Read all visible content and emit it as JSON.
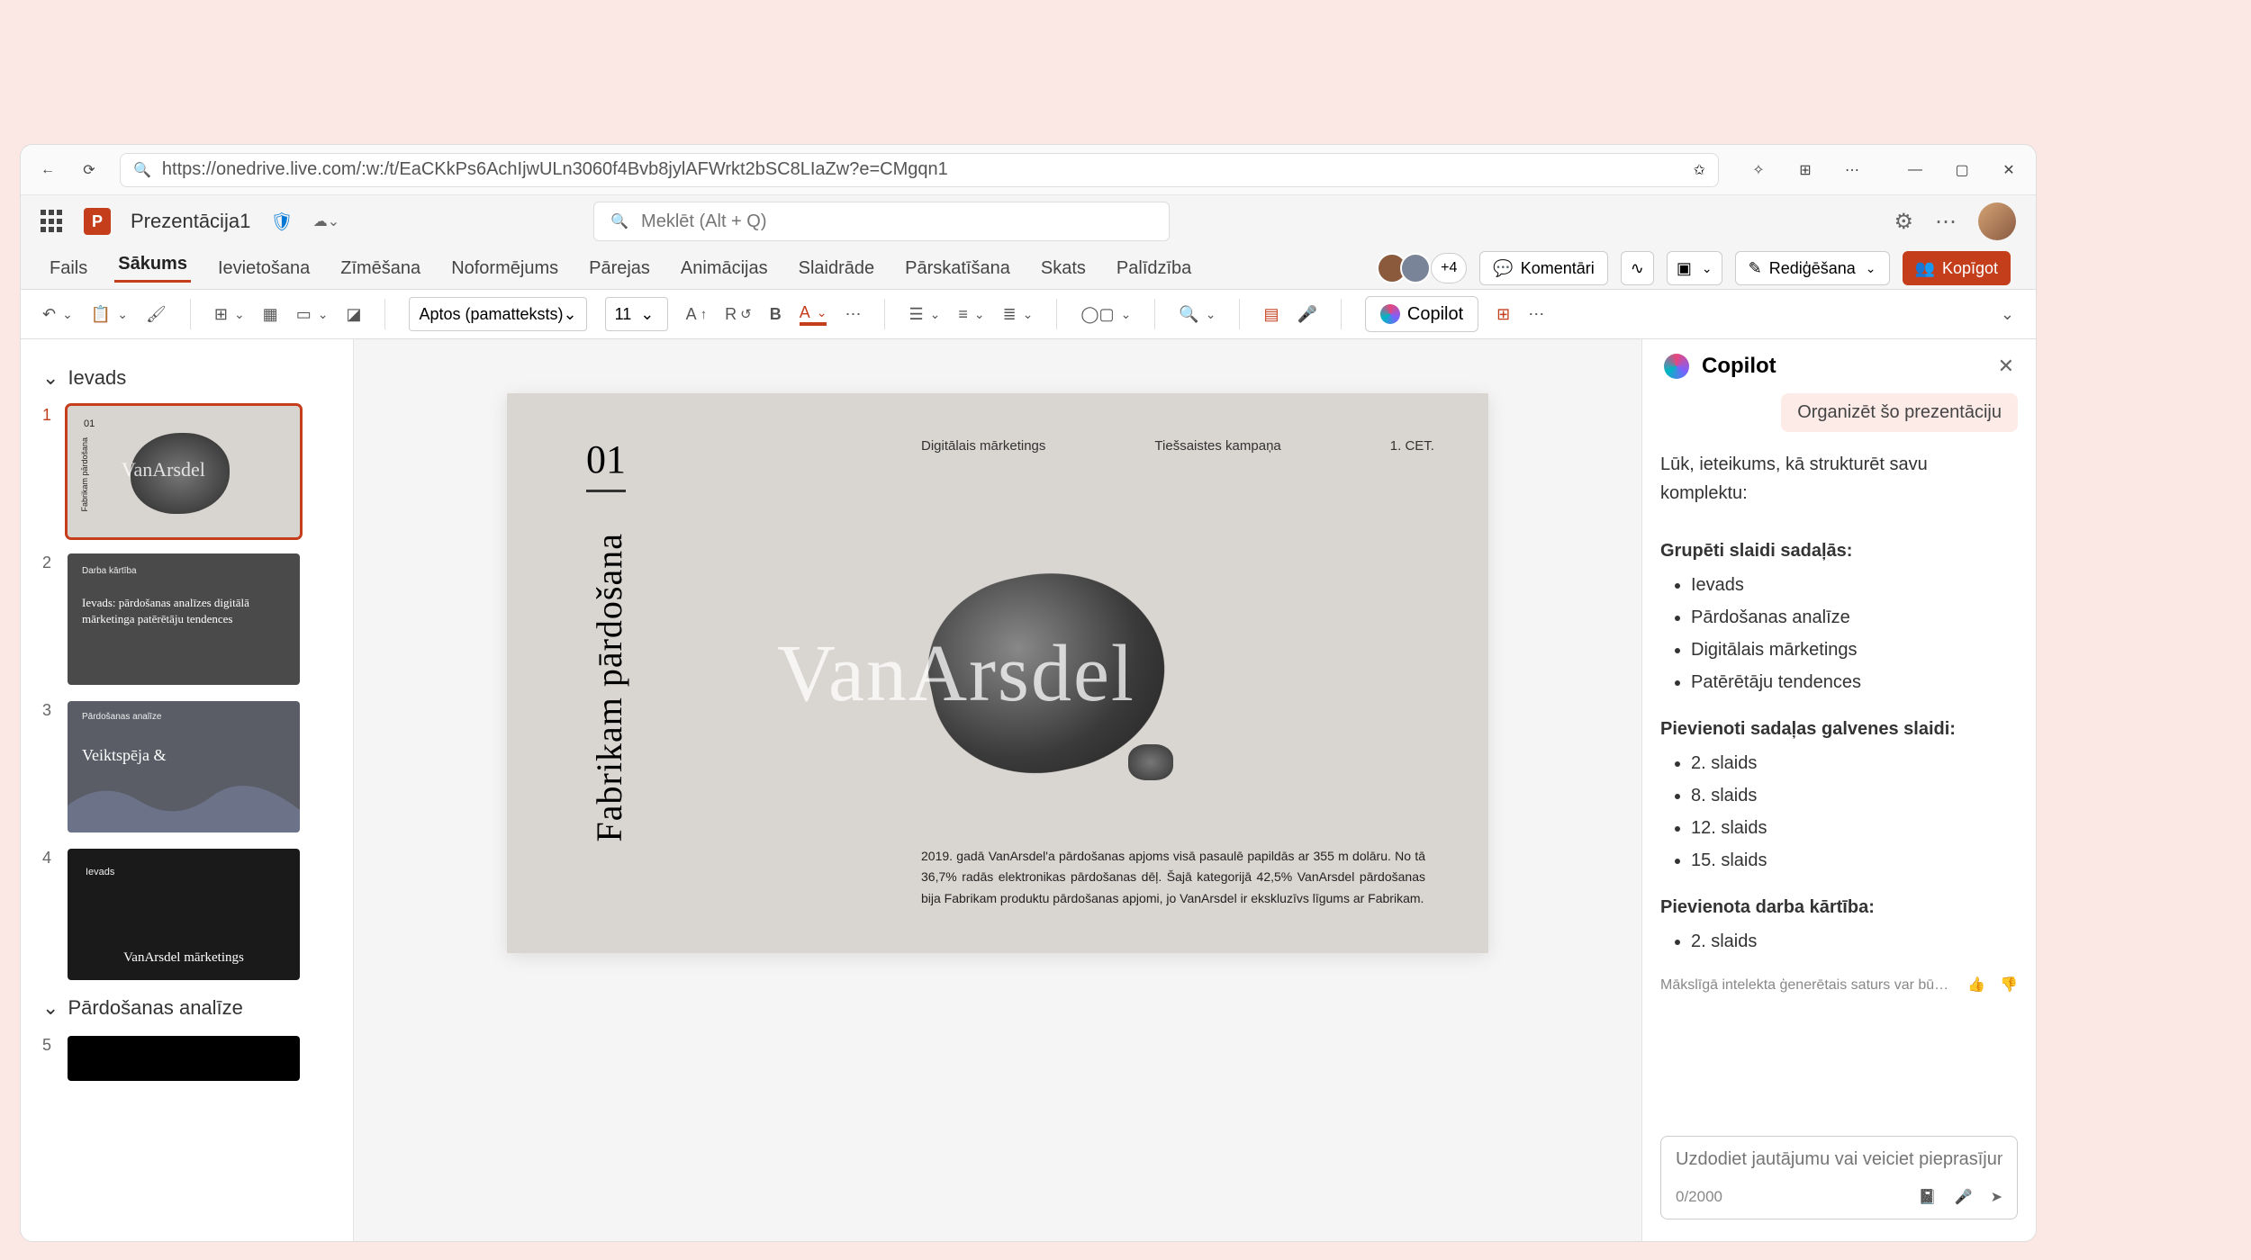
{
  "browser": {
    "url": "https://onedrive.live.com/:w:/t/EaCKkPs6AchIjwULn3060f4Bvb8jylAFWrkt2bSC8LIaZw?e=CMgqn1"
  },
  "header": {
    "doc_title": "Prezentācija1",
    "search_placeholder": "Meklēt (Alt + Q)"
  },
  "tabs": {
    "items": [
      "Fails",
      "Sākums",
      "Ievietošana",
      "Zīmēšana",
      "Noformējums",
      "Pārejas",
      "Animācijas",
      "Slaidrāde",
      "Pārskatīšana",
      "Skats",
      "Palīdzība"
    ],
    "active": 1,
    "collab_more": "+4",
    "comments": "Komentāri",
    "editing": "Rediģēšana",
    "share": "Kopīgot"
  },
  "toolbar": {
    "font_name": "Aptos (pamatteksts)",
    "font_size": "11",
    "copilot": "Copilot"
  },
  "sections": {
    "s1": "Ievads",
    "s2": "Pārdošanas analīze"
  },
  "thumbnails": {
    "t2a": "Darba kārtība",
    "t2b": "Ievads: pārdošanas analīzes digitālā mārketinga patērētāju tendences",
    "t3a": "Pārdošanas analīze",
    "t3b": "Veiktspēja &",
    "t4a": "Ievads",
    "t4b": "VanArsdel mārketings"
  },
  "slide": {
    "num": "01",
    "vtext": "Fabrikam pārdošana",
    "tag1": "Digitālais mārketings",
    "tag2": "Tiešsaistes kampaņa",
    "tag3": "1. CET.",
    "brand": "VanArsdel",
    "body": "2019. gadā VanArsdel'a pārdošanas apjoms visā pasaulē papildās ar 355 m dolāru. No tā 36,7% radās elektronikas pārdošanas dēļ. Šajā kategorijā 42,5% VanArsdel pārdošanas bija Fabrikam produktu pārdošanas apjomi, jo VanArsdel ir ekskluzīvs līgums ar Fabrikam."
  },
  "copilot": {
    "title": "Copilot",
    "chip": "Organizēt šo prezentāciju",
    "intro": "Lūk, ieteikums, kā strukturēt savu komplektu:",
    "h1": "Grupēti slaidi sadaļās:",
    "l1": [
      "Ievads",
      "Pārdošanas analīze",
      "Digitālais mārketings",
      "Patērētāju tendences"
    ],
    "h2": "Pievienoti sadaļas galvenes slaidi:",
    "l2": [
      "2. slaids",
      "8. slaids",
      "12. slaids",
      "15. slaids"
    ],
    "h3": "Pievienota darba kārtība:",
    "l3": [
      "2. slaids"
    ],
    "disclaimer": "Mākslīgā intelekta ģenerētais saturs var bū…",
    "placeholder": "Uzdodiet jautājumu vai veiciet pieprasījumu.",
    "count": "0/2000"
  }
}
